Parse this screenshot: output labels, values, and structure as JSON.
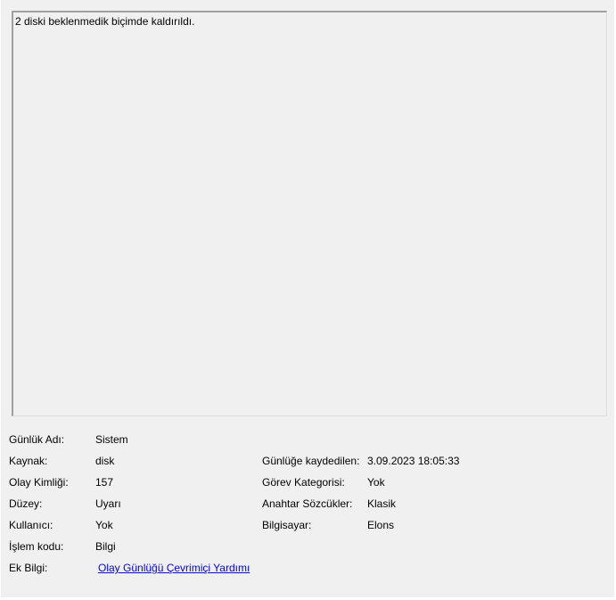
{
  "description": "2 diski beklenmedik biçimde kaldırıldı.",
  "details": {
    "log_name": {
      "label": "Günlük Adı:",
      "value": "Sistem"
    },
    "source": {
      "label": "Kaynak:",
      "value": "disk"
    },
    "event_id": {
      "label": "Olay Kimliği:",
      "value": "157"
    },
    "level": {
      "label": "Düzey:",
      "value": "Uyarı"
    },
    "user": {
      "label": "Kullanıcı:",
      "value": "Yok"
    },
    "opcode": {
      "label": "İşlem kodu:",
      "value": "Bilgi"
    },
    "more_info": {
      "label": "Ek Bilgi:",
      "link_text": "Olay Günlüğü Çevrimiçi Yardımı"
    },
    "logged": {
      "label": "Günlüğe kaydedilen:",
      "value": "3.09.2023 18:05:33"
    },
    "task_category": {
      "label": "Görev Kategorisi:",
      "value": "Yok"
    },
    "keywords": {
      "label": "Anahtar Sözcükler:",
      "value": "Klasik"
    },
    "computer": {
      "label": "Bilgisayar:",
      "value": "Elons"
    }
  }
}
